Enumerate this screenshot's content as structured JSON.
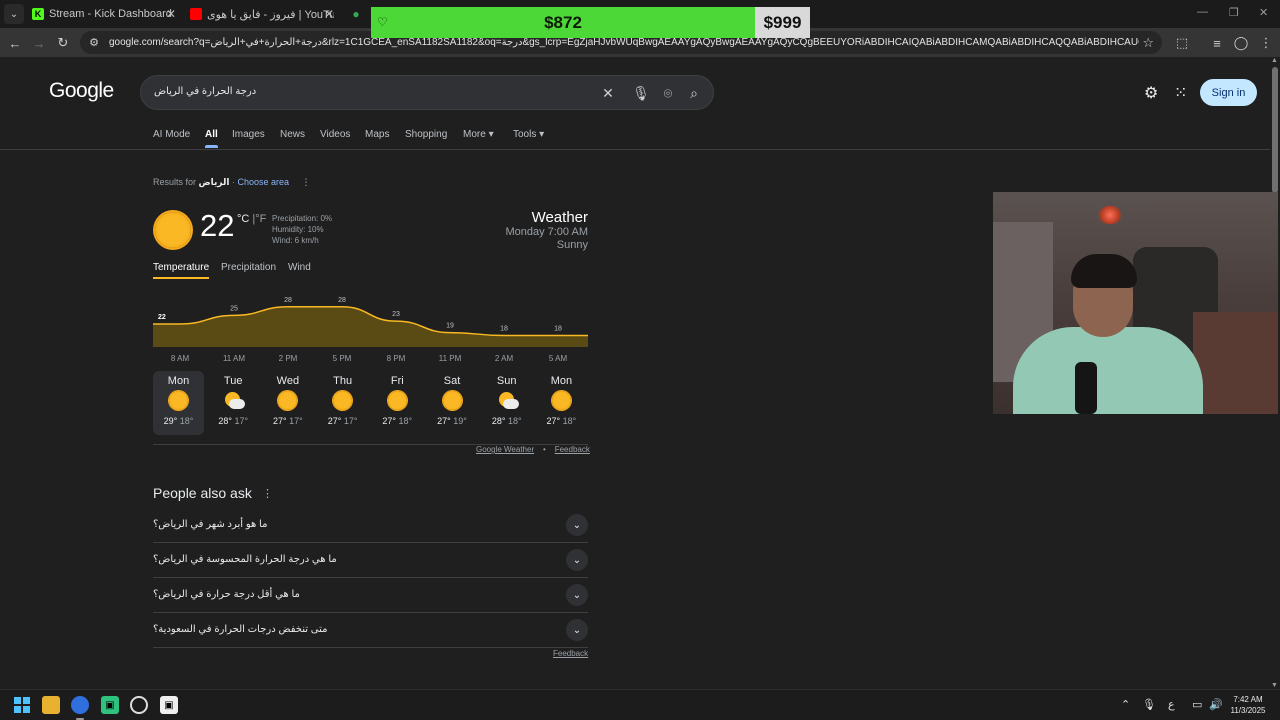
{
  "browser": {
    "tabs": [
      {
        "title": "Stream - Kick Dashboard",
        "favicon": "kick-icon"
      },
      {
        "title": "فيروز - فايق يا هوى | YouTube",
        "favicon": "youtube-icon"
      },
      {
        "title": "",
        "favicon": "maps-icon"
      }
    ],
    "url": "google.com/search?q=درجة+الحرارة+في+الرياض&rlz=1C1GCEA_enSA1182SA1182&oq=درجة&gs_lcrp=EgZjaHJvbWUqBwgAEAAYgAQyBwgAEAAYgAQyCQgBEEUYORiABDIHCAIQABiABDIHCAMQABiABDIHCAQQABiABDIHCAUQABiABDIHCAYQABiABD..."
  },
  "overlay": {
    "current": "$872",
    "goal": "$999",
    "progress": 0.873
  },
  "google": {
    "logo": "Google",
    "query": "درجة الحرارة في الرياض",
    "signin": "Sign in",
    "nav": [
      "AI Mode",
      "All",
      "Images",
      "News",
      "Videos",
      "Maps",
      "Shopping",
      "More",
      "Tools"
    ],
    "active_nav": "All",
    "results_for_prefix": "Results for",
    "results_for_place": "الرياض",
    "choose_area": "Choose area"
  },
  "weather": {
    "temp": "22",
    "unit_c": "°C",
    "unit_sep": "|",
    "unit_f": "°F",
    "precipitation": "Precipitation: 0%",
    "humidity": "Humidity: 10%",
    "wind": "Wind: 6 km/h",
    "title": "Weather",
    "time": "Monday 7:00 AM",
    "condition": "Sunny",
    "tabs": [
      "Temperature",
      "Precipitation",
      "Wind"
    ],
    "hours": [
      "8 AM",
      "11 AM",
      "2 PM",
      "5 PM",
      "8 PM",
      "11 PM",
      "2 AM",
      "5 AM"
    ],
    "days": [
      {
        "name": "Mon",
        "icon": "sun-icon",
        "hi": "29°",
        "lo": "18°"
      },
      {
        "name": "Tue",
        "icon": "partly-cloudy-icon",
        "hi": "28°",
        "lo": "17°"
      },
      {
        "name": "Wed",
        "icon": "sun-icon",
        "hi": "27°",
        "lo": "17°"
      },
      {
        "name": "Thu",
        "icon": "sun-icon",
        "hi": "27°",
        "lo": "17°"
      },
      {
        "name": "Fri",
        "icon": "sun-icon",
        "hi": "27°",
        "lo": "18°"
      },
      {
        "name": "Sat",
        "icon": "sun-icon",
        "hi": "27°",
        "lo": "19°"
      },
      {
        "name": "Sun",
        "icon": "partly-cloudy-icon",
        "hi": "28°",
        "lo": "18°"
      },
      {
        "name": "Mon",
        "icon": "sun-icon",
        "hi": "27°",
        "lo": "18°"
      }
    ],
    "footer_source": "Google Weather",
    "footer_sep": "•",
    "footer_feedback": "Feedback"
  },
  "chart_data": {
    "type": "area",
    "x": [
      "7 AM",
      "8 AM",
      "11 AM",
      "2 PM",
      "5 PM",
      "8 PM",
      "11 PM",
      "2 AM",
      "5 AM",
      "7 AM"
    ],
    "series": [
      {
        "values": [
          22,
          22,
          25,
          28,
          28,
          23,
          19,
          18,
          18,
          18
        ]
      }
    ],
    "point_labels": [
      "22",
      "25",
      "28",
      "28",
      "23",
      "19",
      "18",
      "18"
    ],
    "ylim": [
      14,
      30
    ],
    "color": "#f9b824",
    "grid": false
  },
  "people_also_ask": {
    "title": "People also ask",
    "questions": [
      "ما هو أبرد شهر في الرياض؟",
      "ما هي درجة الحرارة المحسوسة في الرياض؟",
      "ما هي أقل درجة حرارة في الرياض؟",
      "متى تنخفض درجات الحرارة في السعودية؟"
    ],
    "feedback": "Feedback"
  },
  "taskbar": {
    "time": "7:42 AM",
    "date": "11/3/2025",
    "lang": "ع"
  }
}
